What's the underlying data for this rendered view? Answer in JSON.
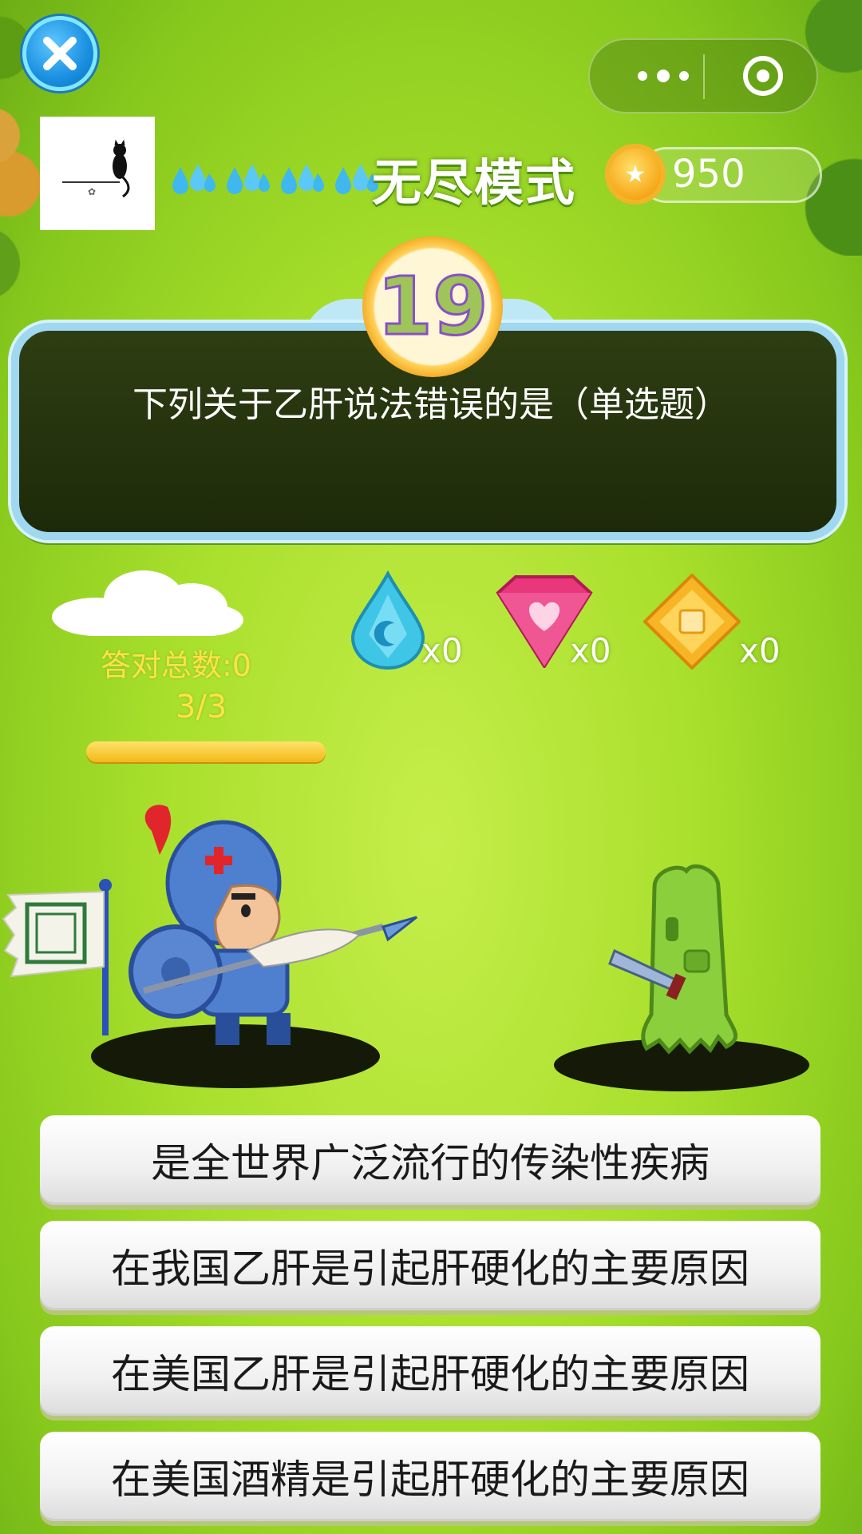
{
  "header": {
    "mode_title": "无尽模式",
    "coins": "950",
    "lives_icons": [
      "water-drops-icon",
      "water-drops-icon",
      "water-drops-icon",
      "water-drops-icon"
    ]
  },
  "question": {
    "number": "19",
    "text": "下列关于乙肝说法错误的是（单选题）"
  },
  "stats": {
    "correct_total": "答对总数:0",
    "progress": "3/3",
    "progress_fraction": 1.0
  },
  "items": [
    {
      "icon": "blue-water-gem-icon",
      "count": "x0"
    },
    {
      "icon": "pink-heart-gem-icon",
      "count": "x0"
    },
    {
      "icon": "gold-diamond-gem-icon",
      "count": "x0"
    }
  ],
  "answers": [
    "是全世界广泛流行的传染性疾病",
    "在我国乙肝是引起肝硬化的主要原因",
    "在美国乙肝是引起肝硬化的主要原因",
    "在美国酒精是引起肝硬化的主要原因"
  ],
  "colors": {
    "accent_yellow": "#ffe14a",
    "panel_border": "#9fd8f0",
    "background_green": "#a8df2c"
  }
}
